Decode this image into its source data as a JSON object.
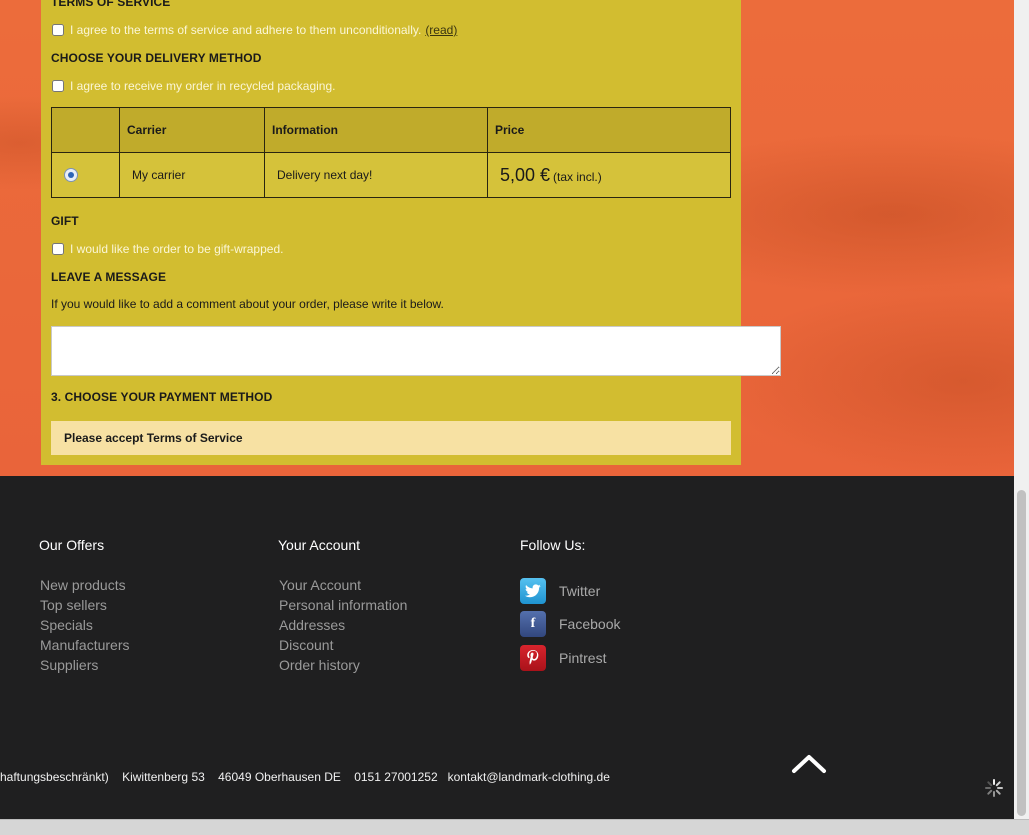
{
  "terms": {
    "heading": "TERMS OF SERVICE",
    "agree_label": "I agree to the terms of service and adhere to them unconditionally.",
    "read_link": "(read)"
  },
  "delivery": {
    "heading": "CHOOSE YOUR DELIVERY METHOD",
    "recycled_label": "I agree to receive my order in recycled packaging.",
    "table": {
      "headers": [
        "",
        "Carrier",
        "Information",
        "Price"
      ],
      "row": {
        "carrier": "My carrier",
        "information": "Delivery next day!",
        "price": "5,00 €",
        "price_note": "(tax incl.)"
      }
    }
  },
  "gift": {
    "heading": "GIFT",
    "label": "I would like the order to be gift-wrapped."
  },
  "message": {
    "heading": "LEAVE A MESSAGE",
    "intro": "If you would like to add a comment about your order, please write it below.",
    "value": ""
  },
  "payment": {
    "heading": "3. CHOOSE YOUR PAYMENT METHOD",
    "warning": "Please accept Terms of Service"
  },
  "footer": {
    "offers": {
      "title": "Our Offers",
      "items": [
        "New products",
        "Top sellers",
        "Specials",
        "Manufacturers",
        "Suppliers"
      ]
    },
    "account": {
      "title": "Your Account",
      "items": [
        "Your Account",
        "Personal information",
        "Addresses",
        "Discount",
        "Order history"
      ]
    },
    "follow": {
      "title": "Follow Us:",
      "items": [
        {
          "name": "Twitter",
          "icon": "twitter-icon"
        },
        {
          "name": "Facebook",
          "icon": "facebook-icon"
        },
        {
          "name": "Pintrest",
          "icon": "pinterest-icon"
        }
      ]
    },
    "address": "haftungsbeschränkt)    Kiwittenberg 53    46049 Oberhausen DE    0151 27001252   kontakt@landmark-clothing.de"
  },
  "colors": {
    "page_bg": "#ea6a3a",
    "panel": "#d2bd30",
    "footer": "#1f1f20",
    "warning_bg": "#f7e1a3"
  }
}
